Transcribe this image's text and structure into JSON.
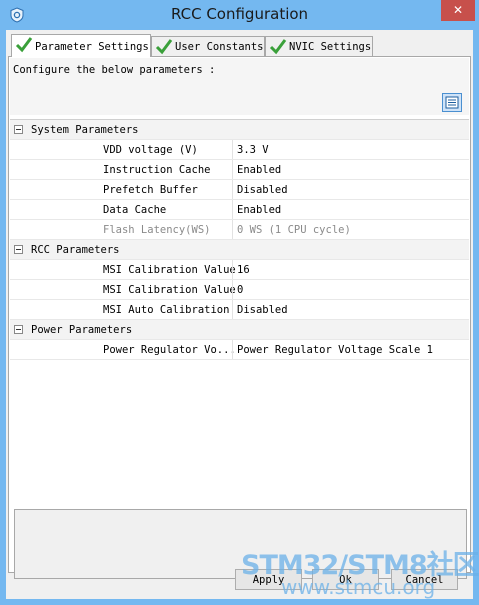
{
  "window": {
    "title": "RCC Configuration",
    "close_label": "✕"
  },
  "tabs": [
    {
      "label": "Parameter Settings",
      "active": true
    },
    {
      "label": "User Constants",
      "active": false
    },
    {
      "label": "NVIC Settings",
      "active": false
    }
  ],
  "configure_label": "Configure the below parameters :",
  "groups": {
    "system": {
      "label": "System Parameters",
      "rows": [
        {
          "name": "VDD voltage (V)",
          "value": "3.3 V"
        },
        {
          "name": "Instruction Cache",
          "value": "Enabled"
        },
        {
          "name": "Prefetch Buffer",
          "value": "Disabled"
        },
        {
          "name": "Data Cache",
          "value": "Enabled"
        },
        {
          "name": "Flash Latency(WS)",
          "value": "0 WS (1 CPU cycle)"
        }
      ]
    },
    "rcc": {
      "label": "RCC Parameters",
      "rows": [
        {
          "name": "MSI Calibration Value",
          "value": "16"
        },
        {
          "name": "MSI Calibration Value",
          "value": "0"
        },
        {
          "name": "MSI Auto Calibration",
          "value": "Disabled"
        }
      ]
    },
    "power": {
      "label": "Power Parameters",
      "rows": [
        {
          "name": "Power Regulator Vo...",
          "value": "Power Regulator Voltage Scale 1"
        }
      ]
    }
  },
  "buttons": {
    "apply": "Apply",
    "ok": "Ok",
    "cancel": "Cancel"
  },
  "watermark": {
    "line1": "STM32/STM8社区",
    "line2": "www.stmcu.org"
  },
  "colors": {
    "titlebar": "#74b8f0",
    "close": "#c7504b",
    "check": "#3aa03a"
  }
}
